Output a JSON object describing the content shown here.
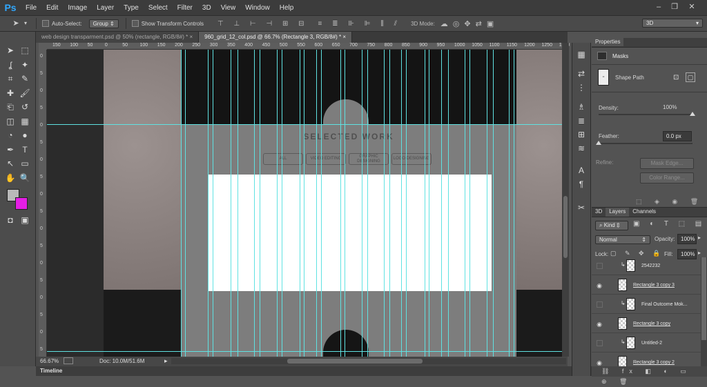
{
  "app": {
    "logo": "Ps"
  },
  "menubar": [
    "File",
    "Edit",
    "Image",
    "Layer",
    "Type",
    "Select",
    "Filter",
    "3D",
    "View",
    "Window",
    "Help"
  ],
  "window_controls": {
    "minimize": "–",
    "restore": "❐",
    "close": "✕"
  },
  "options_bar": {
    "auto_select_label": "Auto-Select:",
    "auto_select_value": "Group",
    "show_transform_label": "Show Transform Controls",
    "mode_3d_label": "3D Mode:",
    "workspace_value": "3D"
  },
  "doc_tabs": [
    {
      "label": "web design transparment.psd @ 50% (rectangle, RGB/8#) *",
      "close": "×"
    },
    {
      "label": "960_grid_12_col.psd @ 66.7% (Rectangle 3, RGB/8#) *",
      "close": "×"
    }
  ],
  "ruler_ticks": [
    "150",
    "100",
    "50",
    "0",
    "50",
    "100",
    "150",
    "200",
    "250",
    "300",
    "350",
    "400",
    "450",
    "500",
    "550",
    "600",
    "650",
    "700",
    "750",
    "800",
    "850",
    "900",
    "950",
    "1000",
    "1050",
    "1100",
    "1150",
    "1200",
    "1250",
    "1300"
  ],
  "ruler_left_ticks": [
    "0",
    "5",
    "0",
    "5",
    "0",
    "5",
    "0",
    "5",
    "0",
    "5",
    "0",
    "5",
    "0",
    "5",
    "0",
    "5",
    "0",
    "5"
  ],
  "canvas": {
    "heading": "SELECTED WORK",
    "filters": [
      "ALL",
      "VIDEO EDITING",
      "GRAPHIC DESIGNING",
      "LOGO DESIGNING"
    ]
  },
  "status": {
    "zoom": "66.67%",
    "doc": "Doc: 10.0M/51.6M"
  },
  "timeline_label": "Timeline",
  "properties": {
    "tab": "Properties",
    "section": "Masks",
    "shape_path": "Shape Path",
    "density_label": "Density:",
    "density_value": "100%",
    "density_level": 1.0,
    "feather_label": "Feather:",
    "feather_value": "0.0 px",
    "feather_level": 0.0,
    "refine_label": "Refine:",
    "mask_edge_button": "Mask Edge...",
    "color_range_button": "Color Range..."
  },
  "layers_panel": {
    "tabs": [
      "3D",
      "Layers",
      "Channels"
    ],
    "kind_label": "Kind",
    "blend_mode": "Normal",
    "opacity_label": "Opacity:",
    "opacity_value": "100%",
    "lock_label": "Lock:",
    "fill_label": "Fill:",
    "fill_value": "100%",
    "layers": [
      {
        "name": "2542232",
        "visible": false
      },
      {
        "name": "Rectangle 3 copy 3",
        "visible": true
      },
      {
        "name": "Final Outcome Mok...",
        "visible": false
      },
      {
        "name": "Rectangle 3 copy",
        "visible": true
      },
      {
        "name": "Untitled-2",
        "visible": false
      },
      {
        "name": "Rectangle 3 copy 2",
        "visible": true
      }
    ]
  },
  "colors": {
    "accent": "#31a8ff",
    "guide": "#5fe2e2",
    "foreground": "#b9b9b9",
    "background": "#e41ee4"
  },
  "icons": [
    "move-tool-icon",
    "marquee-icon",
    "lasso-icon",
    "magic-wand-icon",
    "crop-icon",
    "eyedropper-icon",
    "healing-brush-icon",
    "brush-icon",
    "stamp-icon",
    "history-brush-icon",
    "eraser-icon",
    "gradient-icon",
    "blur-icon",
    "dodge-icon",
    "pen-icon",
    "type-icon",
    "path-select-icon",
    "shape-icon",
    "hand-icon",
    "zoom-icon"
  ]
}
